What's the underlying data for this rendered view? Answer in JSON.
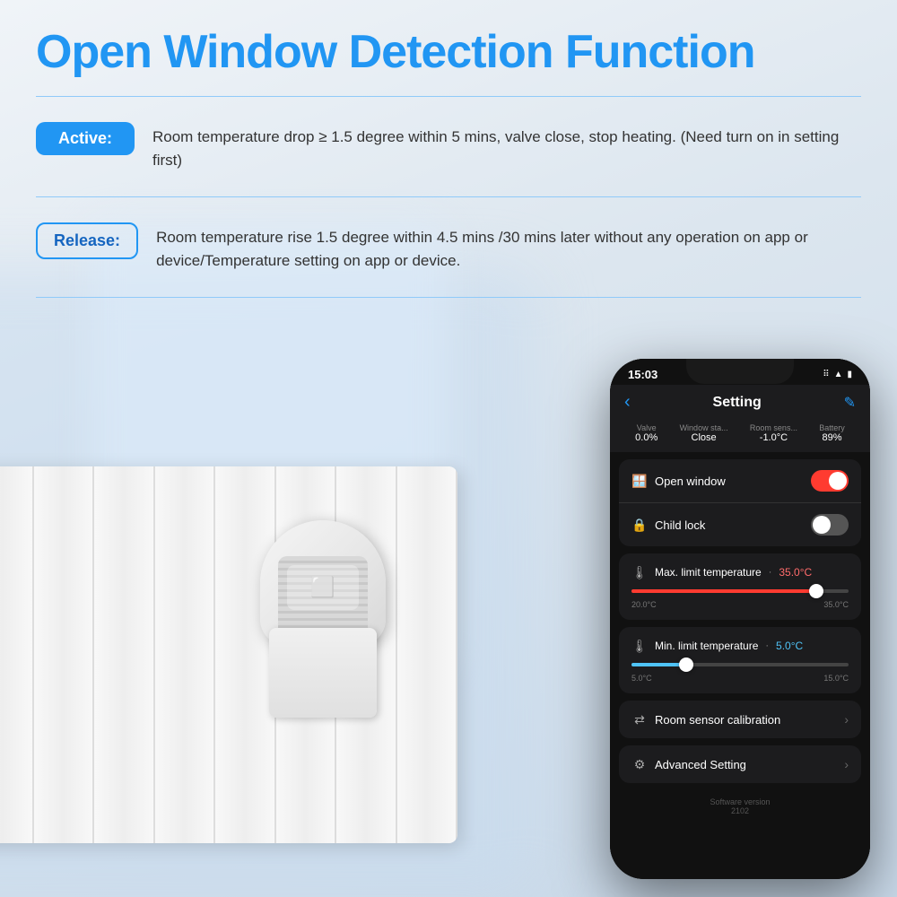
{
  "title": "Open Window Detection Function",
  "divider1": "",
  "active_badge": "Active:",
  "active_text": "Room temperature drop ≥ 1.5 degree within 5 mins, valve close, stop heating. (Need turn on in setting first)",
  "divider2": "",
  "release_badge": "Release:",
  "release_text": "Room temperature rise 1.5 degree within 4.5 mins /30 mins later without any operation on app or device/Temperature setting on app or device.",
  "divider3": "",
  "phone": {
    "status_time": "15:03",
    "status_icons": "⠿ ▲ ●",
    "nav_back": "‹",
    "nav_title": "Setting",
    "nav_edit": "✎",
    "stats": [
      {
        "label": "Valve",
        "value": "0.0%"
      },
      {
        "label": "Window sta...",
        "value": "Close"
      },
      {
        "label": "Room sens...",
        "value": "-1.0°C"
      },
      {
        "label": "Battery",
        "value": "89%"
      }
    ],
    "settings": [
      {
        "icon": "🪟",
        "name": "Open window",
        "type": "toggle-on"
      },
      {
        "icon": "🔒",
        "name": "Child lock",
        "type": "toggle-off"
      }
    ],
    "max_temp_label": "Max. limit temperature",
    "max_temp_value": "35.0°C",
    "max_temp_min": "20.0°C",
    "max_temp_max": "35.0°C",
    "min_temp_label": "Min. limit temperature",
    "min_temp_value": "5.0°C",
    "min_temp_min": "5.0°C",
    "min_temp_max": "15.0°C",
    "room_sensor": "Room sensor calibration",
    "advanced_setting": "Advanced Setting",
    "software_version_label": "Software version",
    "software_version": "2102"
  }
}
